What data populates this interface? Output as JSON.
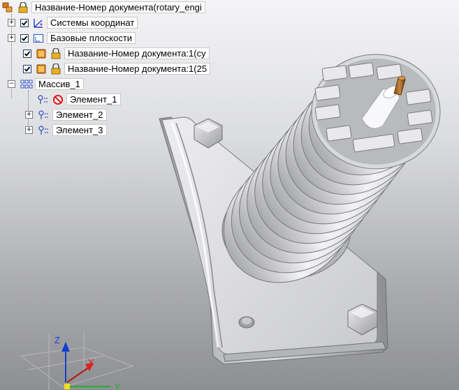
{
  "tree": {
    "root": {
      "label": "Название-Номер документа(rotary_engi"
    },
    "items": [
      {
        "label": "Системы координат",
        "expander": "+",
        "checked": true,
        "icon": "coordinate-system-icon"
      },
      {
        "label": "Базовые плоскости",
        "expander": "+",
        "checked": true,
        "icon": "base-plane-icon"
      },
      {
        "label": "Название-Номер документа:1(су",
        "checked": true,
        "icon": "part-icon"
      },
      {
        "label": "Название-Номер документа:1(25",
        "checked": true,
        "icon": "part-icon"
      },
      {
        "label": "Массив_1",
        "expander": "−",
        "icon": "array-icon"
      }
    ],
    "children": [
      {
        "label": "Элемент_1",
        "icon": "element-icon",
        "status_icon": "excluded-icon"
      },
      {
        "label": "Элемент_2",
        "expander": "+",
        "icon": "element-icon"
      },
      {
        "label": "Элемент_3",
        "expander": "+",
        "icon": "element-icon"
      }
    ]
  },
  "triad": {
    "z": "Z",
    "x": "X",
    "y": "Y"
  },
  "colors": {
    "x_axis": "#e02020",
    "y_axis": "#20b030",
    "z_axis": "#1040d0",
    "selection_border": "#1c3d6e"
  }
}
